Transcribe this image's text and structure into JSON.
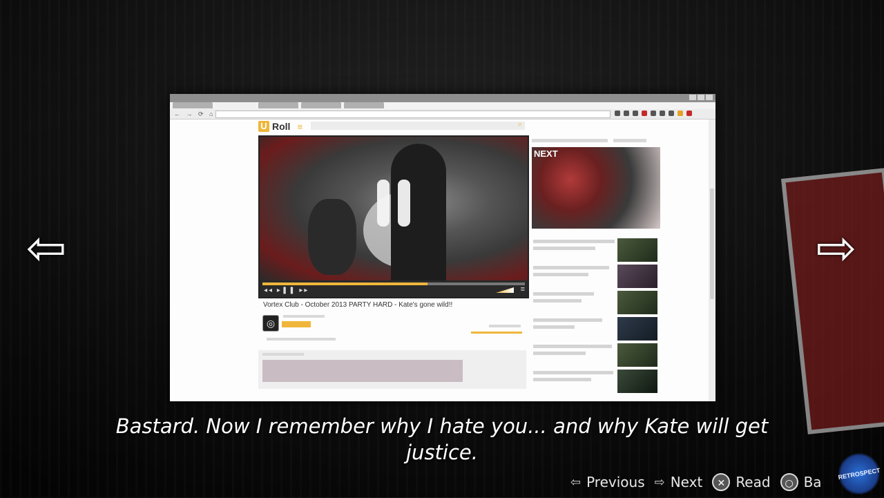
{
  "browser": {
    "site_logo_letter": "U",
    "site_logo_text": "Roll",
    "menu_glyph": "≡",
    "search_glyph": "⌕",
    "nav_glyphs": "← → ⟳ ⌂",
    "video_title": "Vortex Club - October 2013 PARTY HARD - Kate's gone wild!!",
    "next_label": "NEXT",
    "progress_fraction": 0.63,
    "player_controls": "◂◂ ▸❚❚ ▸▸",
    "settings_glyph": "≡",
    "avatar_glyph": "◎",
    "accent_color": "#f0b63b"
  },
  "navigation": {
    "left_arrow_glyph": "⇦",
    "right_arrow_glyph": "⇨"
  },
  "subtitle": "Bastard.  Now I remember why I hate you...  and why Kate will get justice.",
  "prompts": [
    {
      "icon": "⇦",
      "label": "Previous"
    },
    {
      "icon": "⇨",
      "label": "Next"
    },
    {
      "icon": "✕",
      "label": "Read"
    },
    {
      "icon": "○",
      "label": "Ba"
    }
  ],
  "watermark_text": "RETROSPECT"
}
